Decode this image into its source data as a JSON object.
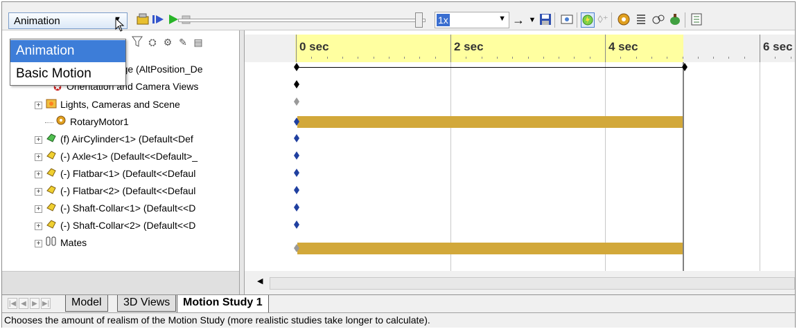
{
  "toolbar": {
    "study_type": "Animation",
    "speed": "1x",
    "icons": [
      "calculate-icon",
      "play-from-start-icon",
      "play-icon",
      "stop-icon",
      "arrow-right-icon",
      "save-animation-icon",
      "animation-wizard-icon",
      "autokey-icon",
      "add-key-icon",
      "motor-icon",
      "spring-icon",
      "contact-icon",
      "gravity-icon",
      "results-icon"
    ]
  },
  "dropdown": {
    "options": [
      "Animation",
      "Basic Motion"
    ],
    "selected_index": 0
  },
  "tree": {
    "rows": [
      {
        "label": "nkage  (AltPosition_De",
        "icon": "assembly-icon",
        "expander": "none"
      },
      {
        "label": "Orientation and Camera Views",
        "icon": "camera-views-icon",
        "expander": "none"
      },
      {
        "label": "Lights, Cameras and Scene",
        "icon": "lights-icon",
        "expander": "plus"
      },
      {
        "label": "RotaryMotor1",
        "icon": "rotary-motor-icon",
        "expander": "none"
      },
      {
        "label": "(f) AirCylinder<1> (Default<Def",
        "icon": "subassembly-icon",
        "expander": "plus"
      },
      {
        "label": "(-) Axle<1> (Default<<Default>_",
        "icon": "part-icon",
        "expander": "plus"
      },
      {
        "label": "(-) Flatbar<1> (Default<<Defaul",
        "icon": "part-icon",
        "expander": "plus"
      },
      {
        "label": "(-) Flatbar<2> (Default<<Defaul",
        "icon": "part-icon",
        "expander": "plus"
      },
      {
        "label": "(-) Shaft-Collar<1> (Default<<D",
        "icon": "part-icon",
        "expander": "plus"
      },
      {
        "label": "(-) Shaft-Collar<2> (Default<<D",
        "icon": "part-icon",
        "expander": "plus"
      },
      {
        "label": "Mates",
        "icon": "mates-icon",
        "expander": "plus"
      }
    ]
  },
  "timeline": {
    "ticks": [
      "0 sec",
      "2 sec",
      "4 sec",
      "6 sec"
    ],
    "colors": {
      "highlight": "#ffffa0",
      "bar": "#d2a83a"
    }
  },
  "tabs": [
    "Model",
    "3D Views",
    "Motion Study 1"
  ],
  "active_tab": "Motion Study 1",
  "status": "Chooses the amount of realism of the Motion Study (more realistic studies take longer to calculate)."
}
